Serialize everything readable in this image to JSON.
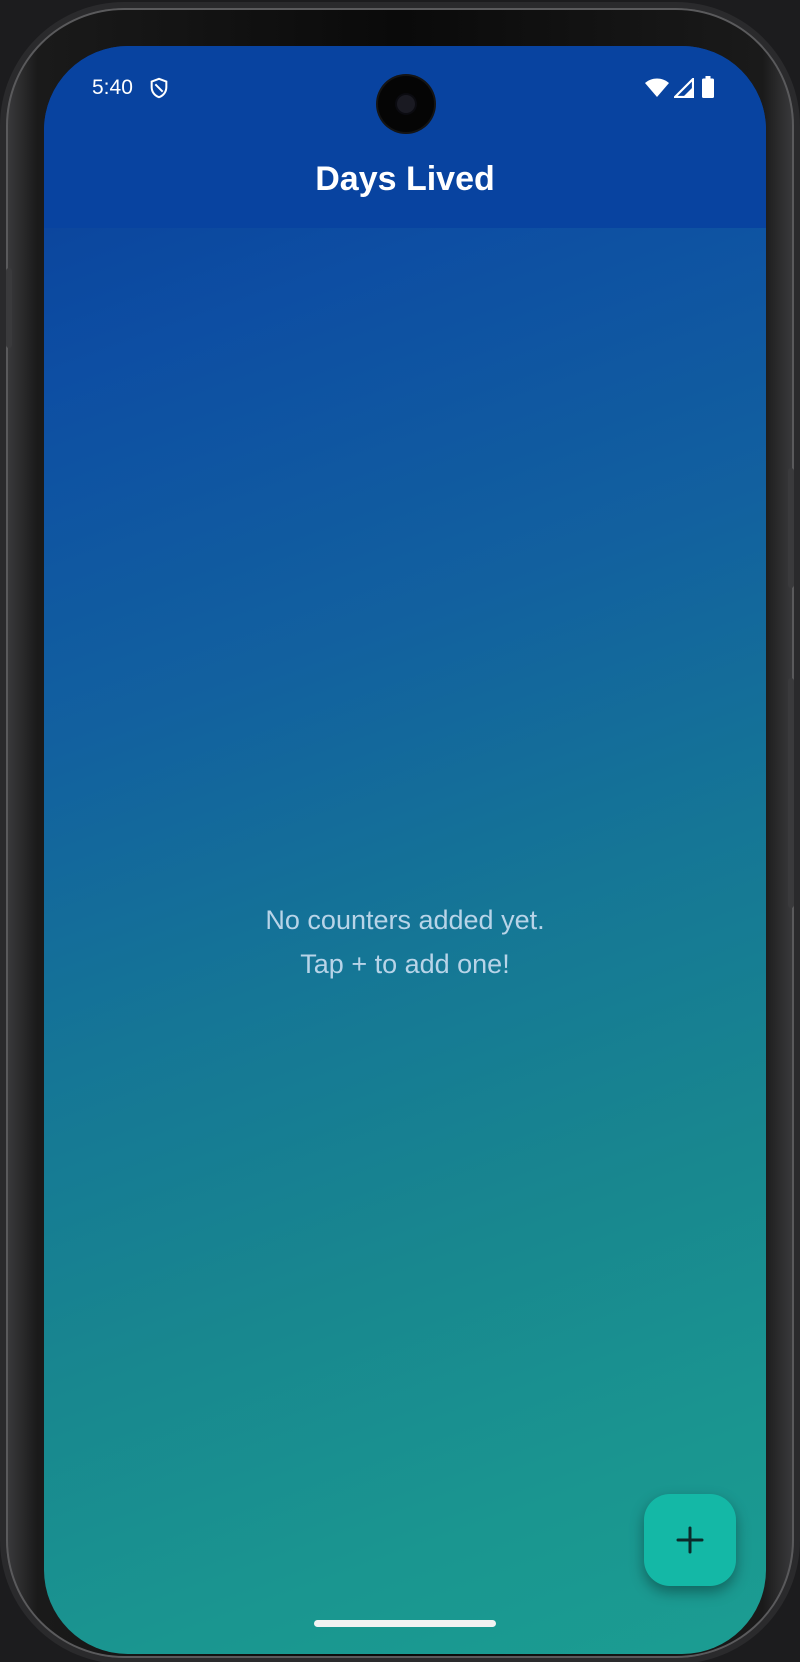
{
  "status_bar": {
    "time": "5:40",
    "icons": [
      "shield-icon",
      "wifi-icon",
      "signal-icon",
      "battery-icon"
    ]
  },
  "app_bar": {
    "title": "Days Lived"
  },
  "empty_state": {
    "line1": "No counters added yet.",
    "line2": "Tap + to add one!"
  },
  "fab": {
    "icon": "plus-icon"
  },
  "colors": {
    "app_bar": "#0843a0",
    "gradient_top": "#0a3d98",
    "gradient_bottom": "#1b9d92",
    "fab": "#14b8a6",
    "empty_text": "#b8d4e8"
  }
}
